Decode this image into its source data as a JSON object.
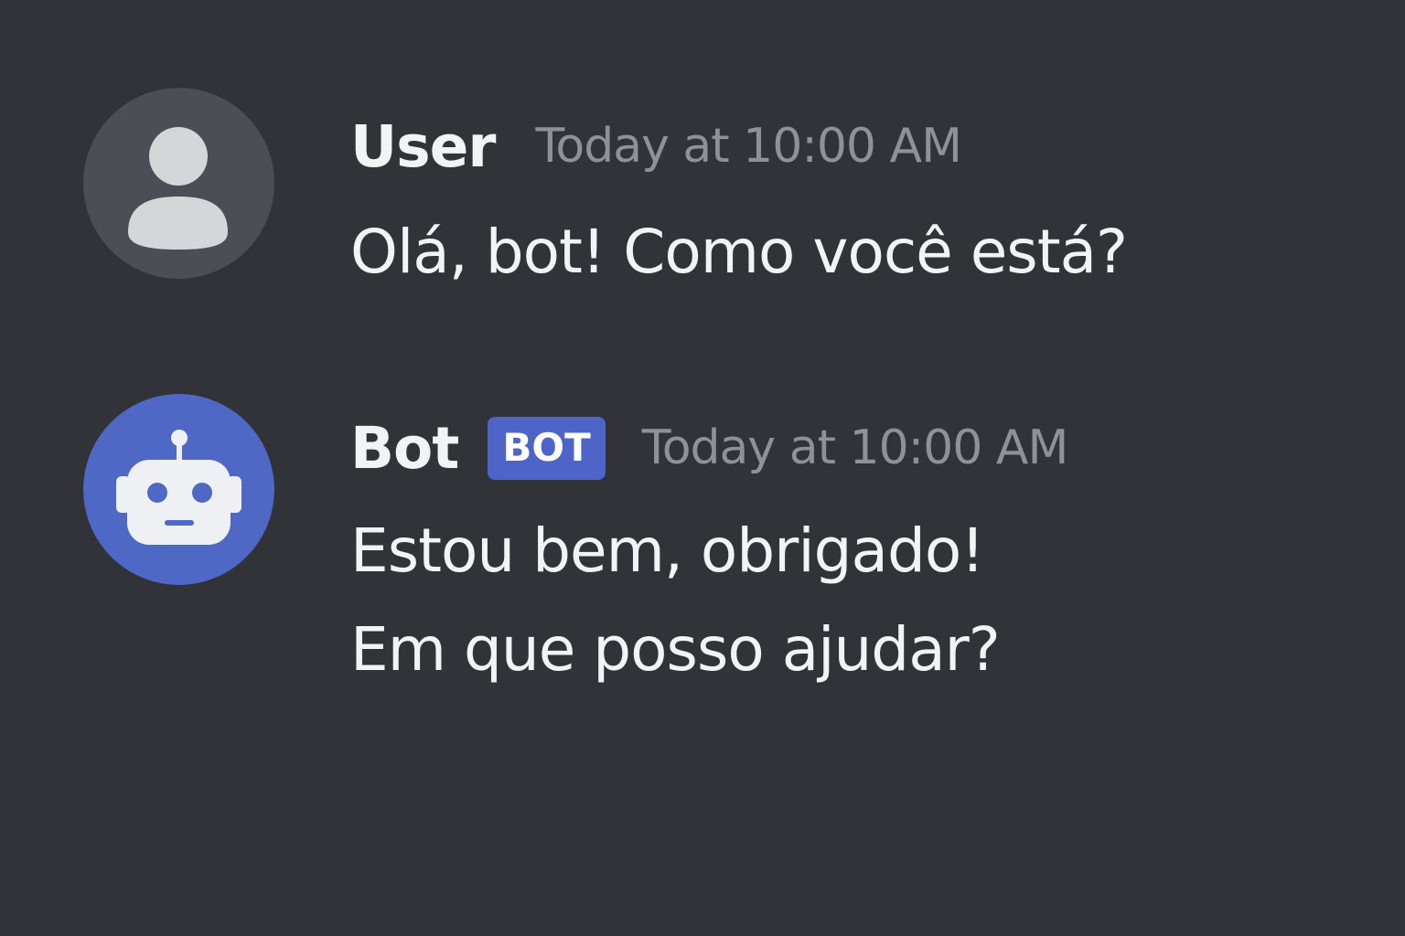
{
  "messages": [
    {
      "author": "User",
      "timestamp": "Today at 10:00 AM",
      "avatar_icon": "user-silhouette-icon",
      "avatar_color": "#4b4e54",
      "lines": [
        "Olá, bot! Como você está?"
      ]
    },
    {
      "author": "Bot",
      "tag": "BOT",
      "timestamp": "Today at 10:00 AM",
      "avatar_icon": "robot-icon",
      "avatar_color": "#4f68c6",
      "lines": [
        "Estou bem, obrigado!",
        "Em que posso ajudar?"
      ]
    }
  ],
  "colors": {
    "background": "#313338",
    "text": "#f2f3f5",
    "timestamp": "#8e9297",
    "bot_tag": "#4f64c8"
  }
}
